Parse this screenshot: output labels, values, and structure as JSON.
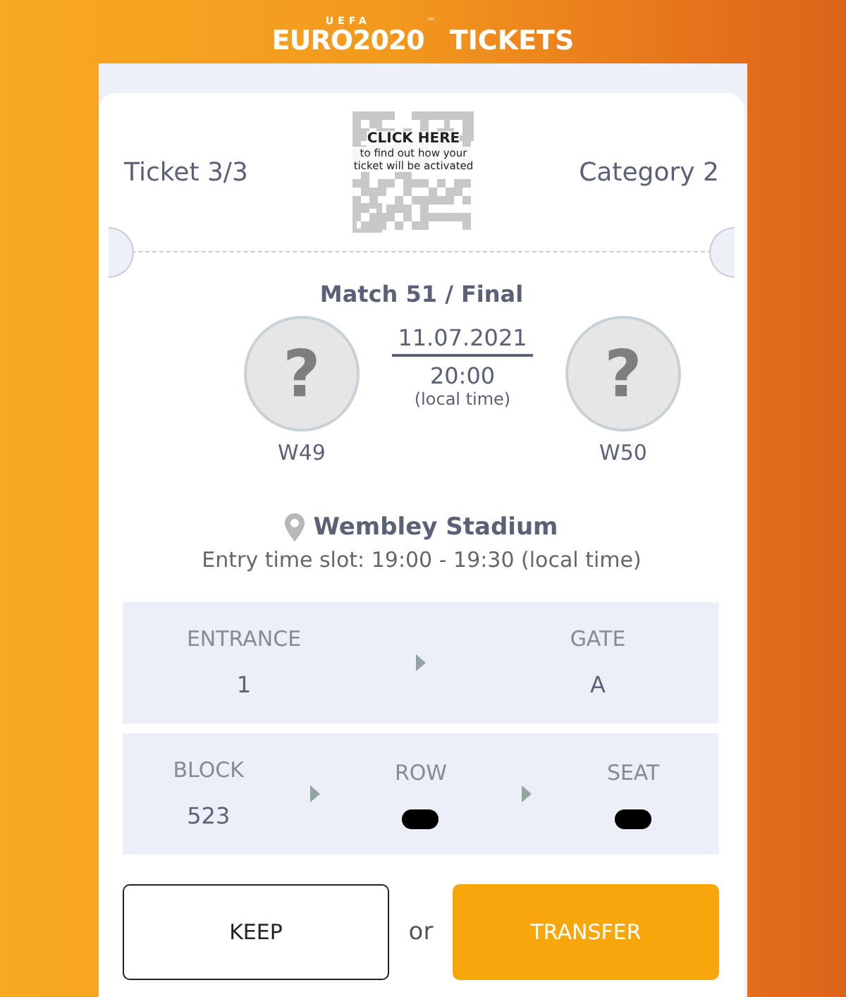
{
  "header": {
    "brand_top": "UEFA",
    "brand": "EURO2020",
    "trademark": "™",
    "title": "TICKETS"
  },
  "ticket": {
    "number": "Ticket 3/3",
    "category": "Category 2",
    "qr_title": "CLICK HERE",
    "qr_text": "to find out how your ticket will be activated"
  },
  "match": {
    "title": "Match 51 / Final",
    "date": "11.07.2021",
    "time": "20:00",
    "time_note": "(local time)",
    "teams": [
      {
        "symbol": "?",
        "name": "W49"
      },
      {
        "symbol": "?",
        "name": "W50"
      }
    ],
    "venue": "Wembley Stadium",
    "entry_slot": "Entry time slot: 19:00 - 19:30 (local time)"
  },
  "seating": [
    [
      {
        "label": "ENTRANCE",
        "value": "1",
        "redacted": false
      },
      {
        "label": "GATE",
        "value": "A",
        "redacted": false
      }
    ],
    [
      {
        "label": "BLOCK",
        "value": "523",
        "redacted": false
      },
      {
        "label": "ROW",
        "redacted": true
      },
      {
        "label": "SEAT",
        "redacted": true
      }
    ]
  ],
  "actions": {
    "keep": "KEEP",
    "separator": "or",
    "transfer": "TRANSFER"
  }
}
